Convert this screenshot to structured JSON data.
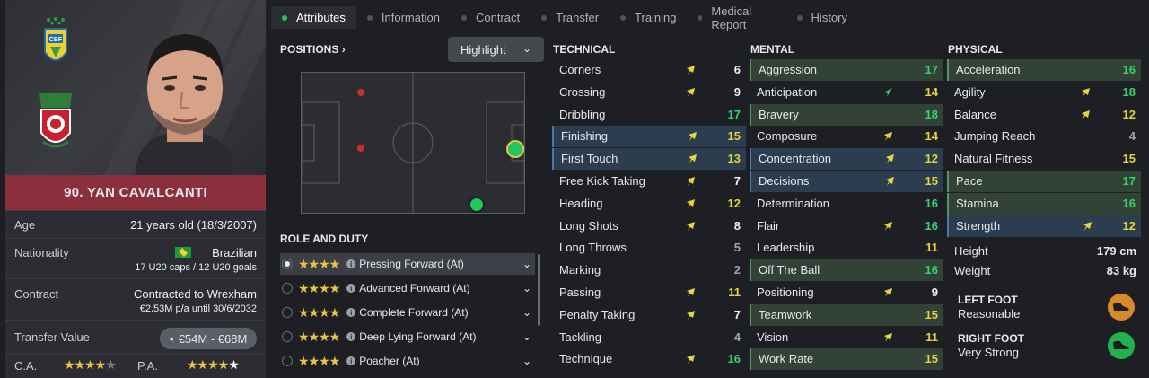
{
  "tabs": [
    {
      "label": "Attributes",
      "active": true
    },
    {
      "label": "Information"
    },
    {
      "label": "Contract"
    },
    {
      "label": "Transfer"
    },
    {
      "label": "Training"
    },
    {
      "label": "Medical Report"
    },
    {
      "label": "History"
    }
  ],
  "player": {
    "name": "90. YAN CAVALCANTI",
    "age_label": "Age",
    "age": "21 years old (18/3/2007)",
    "nationality_label": "Nationality",
    "nationality": "Brazilian",
    "caps": "17 U20 caps / 12 U20 goals",
    "contract_label": "Contract",
    "contract": "Contracted to Wrexham",
    "contract_detail": "€2.53M p/a until 30/6/2032",
    "transfer_label": "Transfer Value",
    "transfer_value": "€54M - €68M",
    "ca_label": "C.A.",
    "pa_label": "P.A.",
    "ca_stars": 4,
    "pa_stars": 4.5
  },
  "positions": {
    "title": "POSITIONS",
    "highlight": "Highlight"
  },
  "roles": {
    "title": "ROLE AND DUTY",
    "items": [
      {
        "label": "Pressing Forward (At)",
        "stars": 4,
        "selected": true
      },
      {
        "label": "Advanced Forward (At)",
        "stars": 4
      },
      {
        "label": "Complete Forward (At)",
        "stars": 4
      },
      {
        "label": "Deep Lying Forward (At)",
        "stars": 4
      },
      {
        "label": "Poacher (At)",
        "stars": 4
      }
    ]
  },
  "technical": {
    "title": "TECHNICAL",
    "items": [
      {
        "name": "Corners",
        "value": "6",
        "arrow": "up",
        "hl": ""
      },
      {
        "name": "Crossing",
        "value": "9",
        "arrow": "up",
        "hl": ""
      },
      {
        "name": "Dribbling",
        "value": "17",
        "arrow": "",
        "hl": ""
      },
      {
        "name": "Finishing",
        "value": "15",
        "arrow": "up",
        "hl": "b"
      },
      {
        "name": "First Touch",
        "value": "13",
        "arrow": "up",
        "hl": "b"
      },
      {
        "name": "Free Kick Taking",
        "value": "7",
        "arrow": "up",
        "hl": ""
      },
      {
        "name": "Heading",
        "value": "12",
        "arrow": "up",
        "hl": ""
      },
      {
        "name": "Long Shots",
        "value": "8",
        "arrow": "up",
        "hl": ""
      },
      {
        "name": "Long Throws",
        "value": "5",
        "arrow": "",
        "hl": ""
      },
      {
        "name": "Marking",
        "value": "2",
        "arrow": "",
        "hl": ""
      },
      {
        "name": "Passing",
        "value": "11",
        "arrow": "up",
        "hl": ""
      },
      {
        "name": "Penalty Taking",
        "value": "7",
        "arrow": "up",
        "hl": ""
      },
      {
        "name": "Tackling",
        "value": "4",
        "arrow": "",
        "hl": ""
      },
      {
        "name": "Technique",
        "value": "16",
        "arrow": "up",
        "hl": ""
      }
    ]
  },
  "mental": {
    "title": "MENTAL",
    "items": [
      {
        "name": "Aggression",
        "value": "17",
        "arrow": "",
        "hl": "g"
      },
      {
        "name": "Anticipation",
        "value": "14",
        "arrow": "upgreen",
        "hl": ""
      },
      {
        "name": "Bravery",
        "value": "18",
        "arrow": "",
        "hl": "g"
      },
      {
        "name": "Composure",
        "value": "14",
        "arrow": "up",
        "hl": ""
      },
      {
        "name": "Concentration",
        "value": "12",
        "arrow": "up",
        "hl": "b"
      },
      {
        "name": "Decisions",
        "value": "15",
        "arrow": "up",
        "hl": "b"
      },
      {
        "name": "Determination",
        "value": "16",
        "arrow": "",
        "hl": ""
      },
      {
        "name": "Flair",
        "value": "16",
        "arrow": "up",
        "hl": ""
      },
      {
        "name": "Leadership",
        "value": "11",
        "arrow": "",
        "hl": ""
      },
      {
        "name": "Off The Ball",
        "value": "16",
        "arrow": "",
        "hl": "g"
      },
      {
        "name": "Positioning",
        "value": "9",
        "arrow": "up",
        "hl": ""
      },
      {
        "name": "Teamwork",
        "value": "15",
        "arrow": "",
        "hl": "g"
      },
      {
        "name": "Vision",
        "value": "11",
        "arrow": "up",
        "hl": ""
      },
      {
        "name": "Work Rate",
        "value": "15",
        "arrow": "",
        "hl": "g"
      }
    ]
  },
  "physical": {
    "title": "PHYSICAL",
    "items": [
      {
        "name": "Acceleration",
        "value": "16",
        "arrow": "",
        "hl": "g"
      },
      {
        "name": "Agility",
        "value": "18",
        "arrow": "up",
        "hl": ""
      },
      {
        "name": "Balance",
        "value": "12",
        "arrow": "up",
        "hl": ""
      },
      {
        "name": "Jumping Reach",
        "value": "4",
        "arrow": "",
        "hl": ""
      },
      {
        "name": "Natural Fitness",
        "value": "15",
        "arrow": "",
        "hl": ""
      },
      {
        "name": "Pace",
        "value": "17",
        "arrow": "",
        "hl": "g"
      },
      {
        "name": "Stamina",
        "value": "16",
        "arrow": "",
        "hl": "g"
      },
      {
        "name": "Strength",
        "value": "12",
        "arrow": "up",
        "hl": "b"
      }
    ],
    "height_label": "Height",
    "height": "179 cm",
    "weight_label": "Weight",
    "weight": "83 kg",
    "left_foot_label": "LEFT FOOT",
    "left_foot": "Reasonable",
    "right_foot_label": "RIGHT FOOT",
    "right_foot": "Very Strong"
  },
  "colors": {
    "accent_green": "#22c55e",
    "banner": "#8b2f3c",
    "foot_left": "#d8892a",
    "foot_right": "#22b14c"
  }
}
